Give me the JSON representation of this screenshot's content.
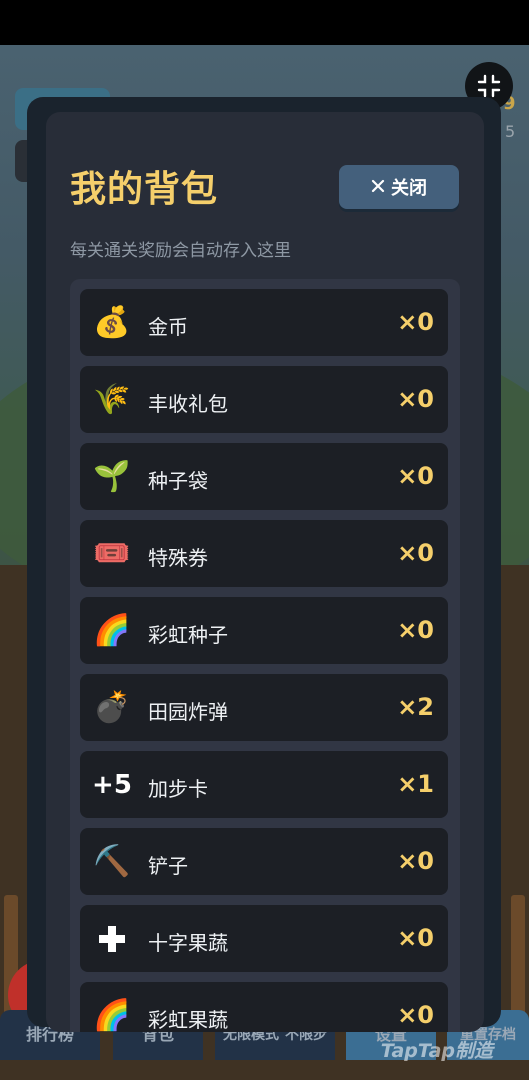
{
  "modal": {
    "title": "我的背包",
    "close_label": "关闭",
    "subtitle": "每关通关奖励会自动存入这里"
  },
  "items": [
    {
      "name": "金币",
      "qty": "×0",
      "icon": "money-bag"
    },
    {
      "name": "丰收礼包",
      "qty": "×0",
      "icon": "rice-sheaf"
    },
    {
      "name": "种子袋",
      "qty": "×0",
      "icon": "seedling"
    },
    {
      "name": "特殊券",
      "qty": "×0",
      "icon": "ticket"
    },
    {
      "name": "彩虹种子",
      "qty": "×0",
      "icon": "rainbow"
    },
    {
      "name": "田园炸弹",
      "qty": "×2",
      "icon": "bomb"
    },
    {
      "name": "加步卡",
      "qty": "×1",
      "icon": "plus-five",
      "icon_text": "+5"
    },
    {
      "name": "铲子",
      "qty": "×0",
      "icon": "pick"
    },
    {
      "name": "十字果蔬",
      "qty": "×0",
      "icon": "cross"
    },
    {
      "name": "彩虹果蔬",
      "qty": "×0",
      "icon": "rainbow"
    }
  ],
  "background_bar": {
    "leaderboard": "排行榜",
    "backpack": "背包",
    "unlimited": "无限模式",
    "no_limit": "不限步",
    "settings": "设置",
    "reset_save": "重置存档"
  },
  "background": {
    "num_top": "9",
    "num_small": "5"
  },
  "watermark": "TapTap制造",
  "colors": {
    "accent": "#f5cf6b",
    "panel": "#282d38",
    "button": "#44607c"
  }
}
